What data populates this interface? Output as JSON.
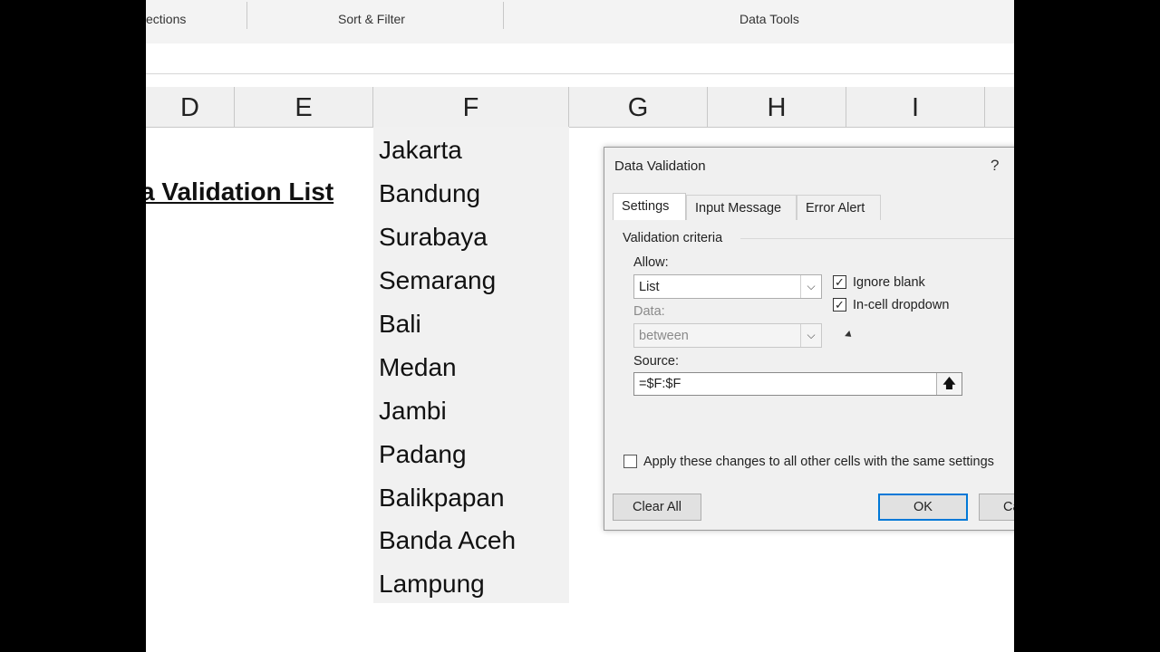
{
  "ribbon": {
    "groups": [
      "ections",
      "Sort & Filter",
      "Data Tools"
    ]
  },
  "columns": [
    "D",
    "E",
    "F",
    "G",
    "H",
    "I"
  ],
  "sheet_title": "a Validation List",
  "cities": [
    "Jakarta",
    "Bandung",
    "Surabaya",
    "Semarang",
    "Bali",
    "Medan",
    "Jambi",
    "Padang",
    "Balikpapan",
    "Banda Aceh",
    "Lampung"
  ],
  "dialog": {
    "title": "Data Validation",
    "help": "?",
    "tabs": [
      "Settings",
      "Input Message",
      "Error Alert"
    ],
    "section": "Validation criteria",
    "allow_label": "Allow:",
    "allow_value": "List",
    "data_label": "Data:",
    "data_value": "between",
    "ignore_blank": "Ignore blank",
    "in_cell_dropdown": "In-cell dropdown",
    "source_label": "Source:",
    "source_value": "=$F:$F",
    "apply_all": "Apply these changes to all other cells with the same settings",
    "clear_all": "Clear All",
    "ok": "OK",
    "cancel": "Ca"
  }
}
